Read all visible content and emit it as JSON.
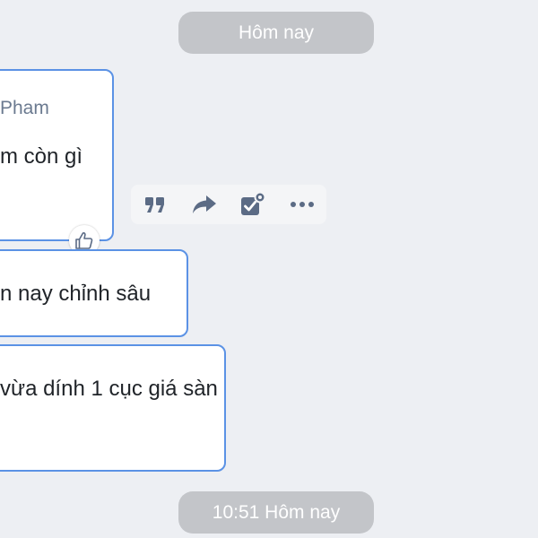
{
  "chat": {
    "date_separator_top": "Hôm nay",
    "date_separator_bottom": "10:51 Hôm nay",
    "messages": [
      {
        "sender": "Pham",
        "text": "m còn gì"
      },
      {
        "text": "n nay chỉnh sâu"
      },
      {
        "text": "vừa dính 1 cục giá sàn"
      }
    ],
    "actions": [
      {
        "name": "quote-icon"
      },
      {
        "name": "forward-icon"
      },
      {
        "name": "task-icon"
      },
      {
        "name": "more-icon"
      }
    ],
    "reaction": {
      "icon": "thumbs-up-icon"
    }
  },
  "colors": {
    "background": "#edeff3",
    "bubble_border": "#5b92e5",
    "icon": "#5b6b85",
    "pill": "#c3c5c9"
  }
}
